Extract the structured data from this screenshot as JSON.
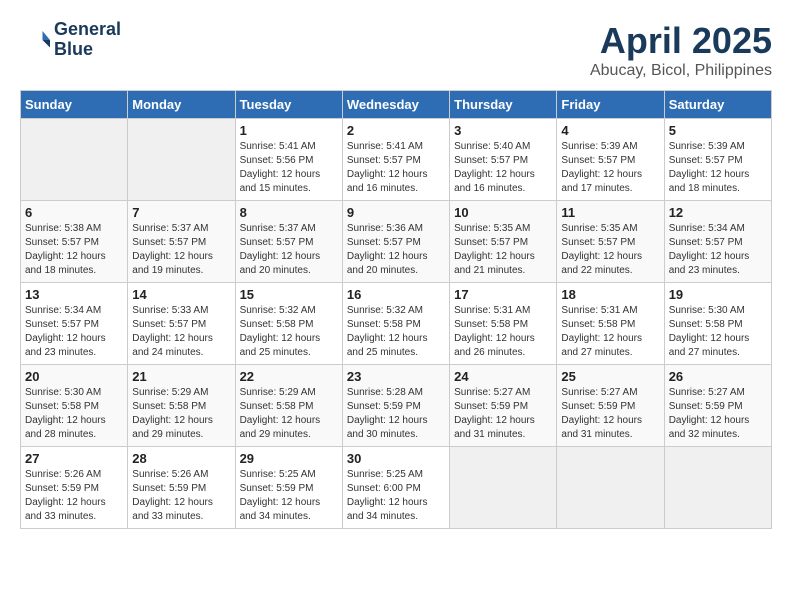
{
  "header": {
    "logo_line1": "General",
    "logo_line2": "Blue",
    "title": "April 2025",
    "subtitle": "Abucay, Bicol, Philippines"
  },
  "calendar": {
    "days_of_week": [
      "Sunday",
      "Monday",
      "Tuesday",
      "Wednesday",
      "Thursday",
      "Friday",
      "Saturday"
    ],
    "weeks": [
      [
        {
          "day": "",
          "info": ""
        },
        {
          "day": "",
          "info": ""
        },
        {
          "day": "1",
          "info": "Sunrise: 5:41 AM\nSunset: 5:56 PM\nDaylight: 12 hours\nand 15 minutes."
        },
        {
          "day": "2",
          "info": "Sunrise: 5:41 AM\nSunset: 5:57 PM\nDaylight: 12 hours\nand 16 minutes."
        },
        {
          "day": "3",
          "info": "Sunrise: 5:40 AM\nSunset: 5:57 PM\nDaylight: 12 hours\nand 16 minutes."
        },
        {
          "day": "4",
          "info": "Sunrise: 5:39 AM\nSunset: 5:57 PM\nDaylight: 12 hours\nand 17 minutes."
        },
        {
          "day": "5",
          "info": "Sunrise: 5:39 AM\nSunset: 5:57 PM\nDaylight: 12 hours\nand 18 minutes."
        }
      ],
      [
        {
          "day": "6",
          "info": "Sunrise: 5:38 AM\nSunset: 5:57 PM\nDaylight: 12 hours\nand 18 minutes."
        },
        {
          "day": "7",
          "info": "Sunrise: 5:37 AM\nSunset: 5:57 PM\nDaylight: 12 hours\nand 19 minutes."
        },
        {
          "day": "8",
          "info": "Sunrise: 5:37 AM\nSunset: 5:57 PM\nDaylight: 12 hours\nand 20 minutes."
        },
        {
          "day": "9",
          "info": "Sunrise: 5:36 AM\nSunset: 5:57 PM\nDaylight: 12 hours\nand 20 minutes."
        },
        {
          "day": "10",
          "info": "Sunrise: 5:35 AM\nSunset: 5:57 PM\nDaylight: 12 hours\nand 21 minutes."
        },
        {
          "day": "11",
          "info": "Sunrise: 5:35 AM\nSunset: 5:57 PM\nDaylight: 12 hours\nand 22 minutes."
        },
        {
          "day": "12",
          "info": "Sunrise: 5:34 AM\nSunset: 5:57 PM\nDaylight: 12 hours\nand 23 minutes."
        }
      ],
      [
        {
          "day": "13",
          "info": "Sunrise: 5:34 AM\nSunset: 5:57 PM\nDaylight: 12 hours\nand 23 minutes."
        },
        {
          "day": "14",
          "info": "Sunrise: 5:33 AM\nSunset: 5:57 PM\nDaylight: 12 hours\nand 24 minutes."
        },
        {
          "day": "15",
          "info": "Sunrise: 5:32 AM\nSunset: 5:58 PM\nDaylight: 12 hours\nand 25 minutes."
        },
        {
          "day": "16",
          "info": "Sunrise: 5:32 AM\nSunset: 5:58 PM\nDaylight: 12 hours\nand 25 minutes."
        },
        {
          "day": "17",
          "info": "Sunrise: 5:31 AM\nSunset: 5:58 PM\nDaylight: 12 hours\nand 26 minutes."
        },
        {
          "day": "18",
          "info": "Sunrise: 5:31 AM\nSunset: 5:58 PM\nDaylight: 12 hours\nand 27 minutes."
        },
        {
          "day": "19",
          "info": "Sunrise: 5:30 AM\nSunset: 5:58 PM\nDaylight: 12 hours\nand 27 minutes."
        }
      ],
      [
        {
          "day": "20",
          "info": "Sunrise: 5:30 AM\nSunset: 5:58 PM\nDaylight: 12 hours\nand 28 minutes."
        },
        {
          "day": "21",
          "info": "Sunrise: 5:29 AM\nSunset: 5:58 PM\nDaylight: 12 hours\nand 29 minutes."
        },
        {
          "day": "22",
          "info": "Sunrise: 5:29 AM\nSunset: 5:58 PM\nDaylight: 12 hours\nand 29 minutes."
        },
        {
          "day": "23",
          "info": "Sunrise: 5:28 AM\nSunset: 5:59 PM\nDaylight: 12 hours\nand 30 minutes."
        },
        {
          "day": "24",
          "info": "Sunrise: 5:27 AM\nSunset: 5:59 PM\nDaylight: 12 hours\nand 31 minutes."
        },
        {
          "day": "25",
          "info": "Sunrise: 5:27 AM\nSunset: 5:59 PM\nDaylight: 12 hours\nand 31 minutes."
        },
        {
          "day": "26",
          "info": "Sunrise: 5:27 AM\nSunset: 5:59 PM\nDaylight: 12 hours\nand 32 minutes."
        }
      ],
      [
        {
          "day": "27",
          "info": "Sunrise: 5:26 AM\nSunset: 5:59 PM\nDaylight: 12 hours\nand 33 minutes."
        },
        {
          "day": "28",
          "info": "Sunrise: 5:26 AM\nSunset: 5:59 PM\nDaylight: 12 hours\nand 33 minutes."
        },
        {
          "day": "29",
          "info": "Sunrise: 5:25 AM\nSunset: 5:59 PM\nDaylight: 12 hours\nand 34 minutes."
        },
        {
          "day": "30",
          "info": "Sunrise: 5:25 AM\nSunset: 6:00 PM\nDaylight: 12 hours\nand 34 minutes."
        },
        {
          "day": "",
          "info": ""
        },
        {
          "day": "",
          "info": ""
        },
        {
          "day": "",
          "info": ""
        }
      ]
    ]
  }
}
